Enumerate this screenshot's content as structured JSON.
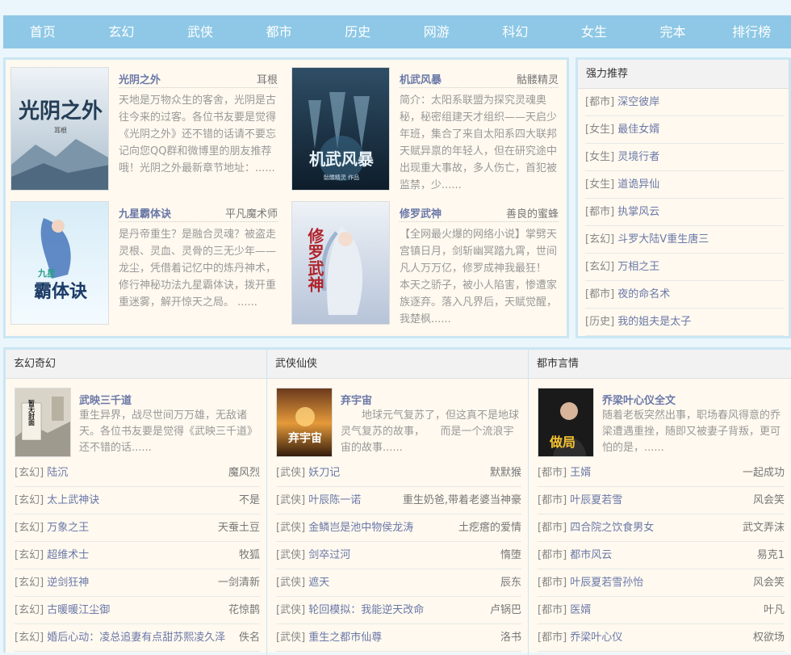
{
  "nav": [
    "首页",
    "玄幻",
    "武侠",
    "都市",
    "历史",
    "网游",
    "科幻",
    "女生",
    "完本",
    "排行榜"
  ],
  "featured": [
    {
      "title": "光阴之外",
      "author": "耳根",
      "desc": "天地是万物众生的客舍，光阴是古往今来的过客。各位书友要是觉得《光阴之外》还不错的话请不要忘记向您QQ群和微博里的朋友推荐哦！光阴之外最新章节地址：......",
      "cover_text": "光阴之外",
      "cover_sub": "耳根"
    },
    {
      "title": "机武风暴",
      "author": "骷髅精灵",
      "desc": "简介：太阳系联盟为探究灵魂奥秘，秘密组建天才组织——天启少年班，集合了来自太阳系四大联邦天赋异禀的年轻人，但在研究途中出现重大事故，多人伤亡，首犯被监禁，少......",
      "cover_text": "机武风暴",
      "cover_sub": "骷髅精灵 作品"
    },
    {
      "title": "九星霸体诀",
      "author": "平凡魔术师",
      "desc": "是丹帝重生？是融合灵魂？被盗走灵根、灵血、灵骨的三无少年——龙尘，凭借着记忆中的炼丹神术，修行神秘功法九星霸体诀，拨开重重迷雾，解开惊天之局。 ......",
      "cover_text": "霸体诀",
      "cover_sub": "九星"
    },
    {
      "title": "修罗武神",
      "author": "善良的蜜蜂",
      "desc": "【全网最火爆的网络小说】掌劈天宫镇日月，剑斩幽冥踏九霄，世间凡人万万亿，修罗成神我最狂！ 本天之骄子，被小人陷害，惨遭家族逐弃。落入凡界后，天赋觉醒，我楚枫......",
      "cover_text": "修罗武神",
      "cover_sub": ""
    }
  ],
  "recommend": {
    "heading": "强力推荐",
    "items": [
      {
        "tag": "[都市]",
        "name": "深空彼岸"
      },
      {
        "tag": "[女生]",
        "name": "最佳女婿"
      },
      {
        "tag": "[女生]",
        "name": "灵境行者"
      },
      {
        "tag": "[女生]",
        "name": "道诡异仙"
      },
      {
        "tag": "[都市]",
        "name": "执掌风云"
      },
      {
        "tag": "[玄幻]",
        "name": "斗罗大陆V重生唐三"
      },
      {
        "tag": "[玄幻]",
        "name": "万相之王"
      },
      {
        "tag": "[都市]",
        "name": "夜的命名术"
      },
      {
        "tag": "[历史]",
        "name": "我的姐夫是太子"
      }
    ]
  },
  "columns": [
    {
      "heading": "玄幻奇幻",
      "feat": {
        "title": "武映三千道",
        "desc": "重生异界，战尽世间万万雄，无敌诸天。各位书友要是觉得《武映三千道》还不错的话......",
        "cover_text": "暂无封面"
      },
      "items": [
        {
          "tag": "[玄幻]",
          "name": "陆沉",
          "author": "魔风烈"
        },
        {
          "tag": "[玄幻]",
          "name": "太上武神诀",
          "author": "不是"
        },
        {
          "tag": "[玄幻]",
          "name": "万象之王",
          "author": "天蚕土豆"
        },
        {
          "tag": "[玄幻]",
          "name": "超维术士",
          "author": "牧狐"
        },
        {
          "tag": "[玄幻]",
          "name": "逆剑狂神",
          "author": "一剑清新"
        },
        {
          "tag": "[玄幻]",
          "name": "古暖暖江尘御",
          "author": "花惊鹊"
        },
        {
          "tag": "[玄幻]",
          "name": "婚后心动：凌总追妻有点甜苏熙凌久泽",
          "author": "佚名"
        }
      ]
    },
    {
      "heading": "武侠仙侠",
      "feat": {
        "title": "弃宇宙",
        "desc": "　　地球元气复苏了，但这真不是地球灵气复苏的故事，　　而是一个流浪宇宙的故事......",
        "cover_text": "弃宇宙"
      },
      "items": [
        {
          "tag": "[武侠]",
          "name": "妖刀记",
          "author": "默默猴"
        },
        {
          "tag": "[武侠]",
          "name": "叶辰陈一诺",
          "author": "重生奶爸,带着老婆当神豪"
        },
        {
          "tag": "[武侠]",
          "name": "金鳞岂是池中物侯龙涛",
          "author": "土疙瘩的爱情"
        },
        {
          "tag": "[武侠]",
          "name": "剑卒过河",
          "author": "惰堕"
        },
        {
          "tag": "[武侠]",
          "name": "遮天",
          "author": "辰东"
        },
        {
          "tag": "[武侠]",
          "name": "轮回模拟：我能逆天改命",
          "author": "卢锅巴"
        },
        {
          "tag": "[武侠]",
          "name": "重生之都市仙尊",
          "author": "洛书"
        }
      ]
    },
    {
      "heading": "都市言情",
      "feat": {
        "title": "乔梁叶心仪全文",
        "desc": "随着老板突然出事，职场春风得意的乔梁遭遇重挫，随即又被妻子背叛，更可怕的是，......",
        "cover_text": "做局"
      },
      "items": [
        {
          "tag": "[都市]",
          "name": "王婿",
          "author": "一起成功"
        },
        {
          "tag": "[都市]",
          "name": "叶辰夏若雪",
          "author": "风会笑"
        },
        {
          "tag": "[都市]",
          "name": "四合院之饮食男女",
          "author": "武文弄沫"
        },
        {
          "tag": "[都市]",
          "name": "都市风云",
          "author": "易克1"
        },
        {
          "tag": "[都市]",
          "name": "叶辰夏若雪孙怡",
          "author": "风会笑"
        },
        {
          "tag": "[都市]",
          "name": "医婿",
          "author": "叶凡"
        },
        {
          "tag": "[都市]",
          "name": "乔梁叶心仪",
          "author": "权欲场"
        }
      ]
    }
  ],
  "colors": {
    "nav": "#8ec8e6",
    "border": "#cbe6f3",
    "panel": "#fff9ef",
    "link": "#6a78a8"
  }
}
